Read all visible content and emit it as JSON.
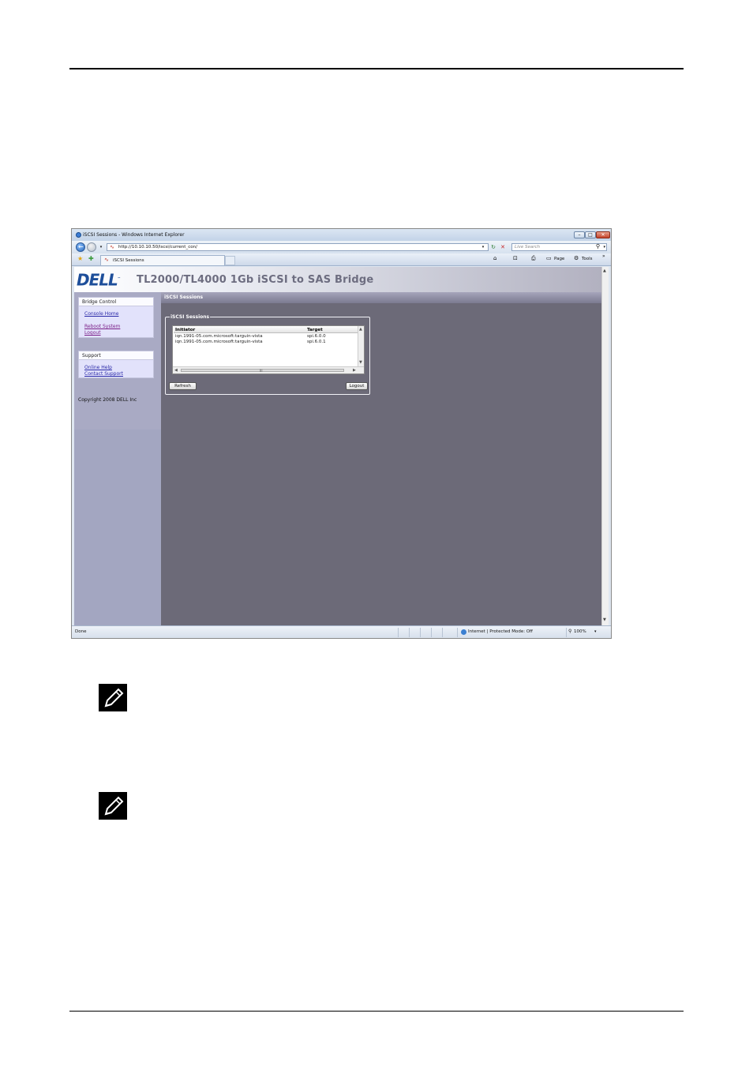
{
  "browser": {
    "window_title": "iSCSI Sessions - Windows Internet Explorer",
    "address": "http://10.10.10.50/iscsi/current_con/",
    "search_placeholder": "Live Search",
    "tab_label": "iSCSI Sessions",
    "cmd_page": "Page",
    "cmd_tools": "Tools",
    "status_text": "Done",
    "zone_text": "Internet | Protected Mode: Off",
    "zoom_text": "100%"
  },
  "app": {
    "logo_text": "DELL",
    "product_title": "TL2000/TL4000 1Gb iSCSI to SAS Bridge",
    "section_title": "iSCSI Sessions",
    "copyright": "Copyright 2008 DELL Inc"
  },
  "sidebar": {
    "bridge_control": {
      "heading": "Bridge Control",
      "links": [
        "Console Home",
        "Reboot System",
        "Logout"
      ]
    },
    "support": {
      "heading": "Support",
      "links": [
        "Online Help",
        "Contact Support"
      ]
    }
  },
  "sessions": {
    "legend": "iSCSI Sessions",
    "columns": [
      "Initiator",
      "Target"
    ],
    "rows": [
      [
        "iqn.1991-05.com.microsoft:targuin-vista",
        "spi.6.0.0"
      ],
      [
        "iqn.1991-05.com.microsoft:targuin-vista",
        "spi.6.0.1"
      ]
    ],
    "scroll_mid": "III",
    "refresh_label": "Refresh",
    "logout_label": "Logout"
  },
  "colors": {
    "dell_blue": "#1d4e9a",
    "content_bg": "#6c6a78",
    "sidebar_bg": "#a9aac4"
  },
  "icons": [
    "note-pencil-icon",
    "note-pencil-icon"
  ]
}
